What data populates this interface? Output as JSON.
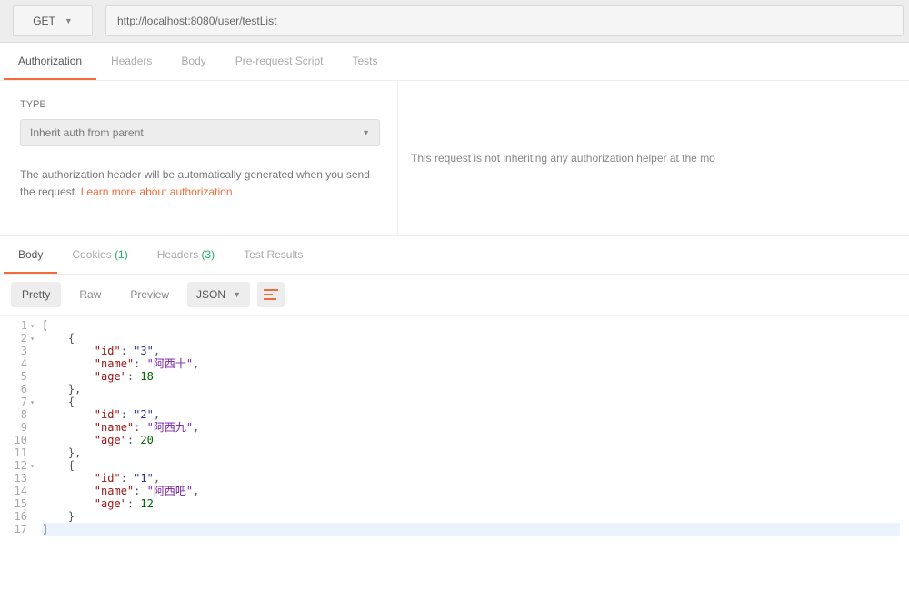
{
  "request": {
    "method": "GET",
    "url": "http://localhost:8080/user/testList"
  },
  "reqtabs": {
    "auth": "Authorization",
    "headers": "Headers",
    "body": "Body",
    "prereq": "Pre-request Script",
    "tests": "Tests"
  },
  "auth": {
    "typeLabel": "TYPE",
    "selected": "Inherit auth from parent",
    "help1": "The authorization header will be automatically generated when you send the request. ",
    "helpLink": "Learn more about authorization",
    "rightNote": "This request is not inheriting any authorization helper at the mo"
  },
  "resp": {
    "body": "Body",
    "cookies": "Cookies",
    "cookiesCount": "(1)",
    "headers": "Headers",
    "headersCount": "(3)",
    "tests": "Test Results"
  },
  "toolbar": {
    "pretty": "Pretty",
    "raw": "Raw",
    "preview": "Preview",
    "format": "JSON"
  },
  "gutter": {
    "l1": "1",
    "l2": "2",
    "l3": "3",
    "l4": "4",
    "l5": "5",
    "l6": "6",
    "l7": "7",
    "l8": "8",
    "l9": "9",
    "l10": "10",
    "l11": "11",
    "l12": "12",
    "l13": "13",
    "l14": "14",
    "l15": "15",
    "l16": "16",
    "l17": "17"
  },
  "body": {
    "open": "[",
    "objOpen": "{",
    "objCloseComma": "},",
    "objClose": "}",
    "close": "]",
    "idKey": "\"id\"",
    "nameKey": "\"name\"",
    "ageKey": "\"age\"",
    "colon": ": ",
    "comma": ",",
    "r1": {
      "id": "\"3\"",
      "name": "\"阿西十\"",
      "age": "18"
    },
    "r2": {
      "id": "\"2\"",
      "name": "\"阿西九\"",
      "age": "20"
    },
    "r3": {
      "id": "\"1\"",
      "name": "\"阿西吧\"",
      "age": "12"
    },
    "ind1": "    ",
    "ind2": "        "
  }
}
